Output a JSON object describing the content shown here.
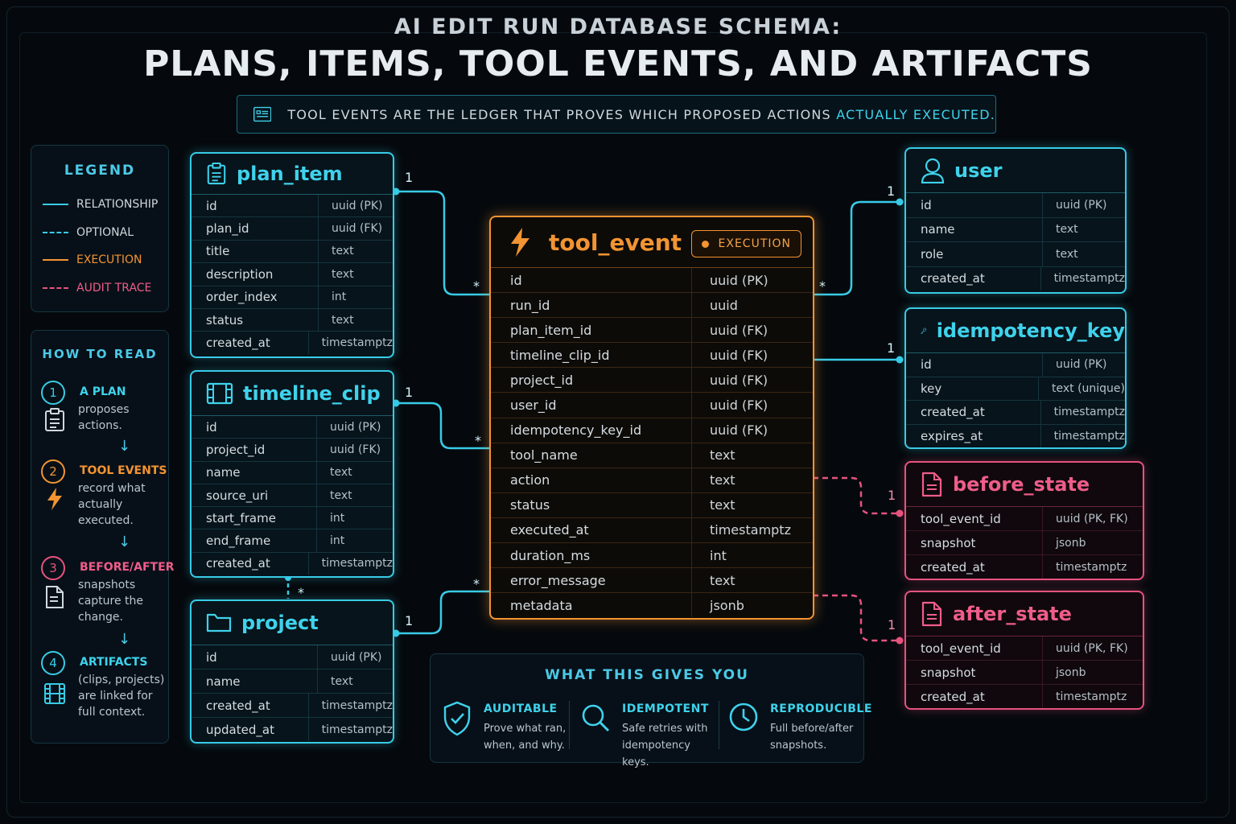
{
  "header": {
    "title_small": "AI EDIT RUN DATABASE SCHEMA:",
    "title_large": "PLANS, ITEMS, TOOL EVENTS, AND ARTIFACTS",
    "banner_text": "TOOL EVENTS ARE THE LEDGER THAT PROVES WHICH PROPOSED ACTIONS ",
    "banner_highlight": "ACTUALLY EXECUTED."
  },
  "legend": {
    "title": "LEGEND",
    "items": [
      {
        "label": "RELATIONSHIP",
        "color": "#38cbe6",
        "style": "solid"
      },
      {
        "label": "OPTIONAL",
        "color": "#38cbe6",
        "style": "dashed"
      },
      {
        "label": "EXECUTION",
        "color": "#f39432",
        "style": "solid"
      },
      {
        "label": "AUDIT TRACE",
        "color": "#e6537f",
        "style": "dashed"
      }
    ]
  },
  "how_to_read": {
    "title": "HOW TO READ",
    "steps": [
      {
        "num": "1",
        "head": "A PLAN",
        "body": "proposes actions.",
        "color": "#38cbe6"
      },
      {
        "num": "2",
        "head": "TOOL EVENTS",
        "body": "record what actually executed.",
        "color": "#f39432"
      },
      {
        "num": "3",
        "head": "BEFORE/AFTER",
        "body": "snapshots capture the change.",
        "color": "#e6537f"
      },
      {
        "num": "4",
        "head": "ARTIFACTS",
        "body": "(clips, projects) are linked for full context.",
        "color": "#38cbe6"
      }
    ],
    "arrow": "↓"
  },
  "tables": {
    "plan_item": {
      "name": "plan_item",
      "icon": "clipboard-icon",
      "columns": [
        [
          "id",
          "uuid (PK)"
        ],
        [
          "plan_id",
          "uuid (FK)"
        ],
        [
          "title",
          "text"
        ],
        [
          "description",
          "text"
        ],
        [
          "order_index",
          "int"
        ],
        [
          "status",
          "text"
        ],
        [
          "created_at",
          "timestamptz"
        ]
      ]
    },
    "timeline_clip": {
      "name": "timeline_clip",
      "icon": "film-icon",
      "columns": [
        [
          "id",
          "uuid (PK)"
        ],
        [
          "project_id",
          "uuid (FK)"
        ],
        [
          "name",
          "text"
        ],
        [
          "source_uri",
          "text"
        ],
        [
          "start_frame",
          "int"
        ],
        [
          "end_frame",
          "int"
        ],
        [
          "created_at",
          "timestamptz"
        ]
      ]
    },
    "project": {
      "name": "project",
      "icon": "folder-icon",
      "columns": [
        [
          "id",
          "uuid (PK)"
        ],
        [
          "name",
          "text"
        ],
        [
          "created_at",
          "timestamptz"
        ],
        [
          "updated_at",
          "timestamptz"
        ]
      ]
    },
    "tool_event": {
      "name": "tool_event",
      "icon": "lightning-icon",
      "badge": "EXECUTION",
      "columns": [
        [
          "id",
          "uuid (PK)"
        ],
        [
          "run_id",
          "uuid"
        ],
        [
          "plan_item_id",
          "uuid (FK)"
        ],
        [
          "timeline_clip_id",
          "uuid (FK)"
        ],
        [
          "project_id",
          "uuid (FK)"
        ],
        [
          "user_id",
          "uuid (FK)"
        ],
        [
          "idempotency_key_id",
          "uuid (FK)"
        ],
        [
          "tool_name",
          "text"
        ],
        [
          "action",
          "text"
        ],
        [
          "status",
          "text"
        ],
        [
          "executed_at",
          "timestamptz"
        ],
        [
          "duration_ms",
          "int"
        ],
        [
          "error_message",
          "text"
        ],
        [
          "metadata",
          "jsonb"
        ]
      ]
    },
    "user": {
      "name": "user",
      "icon": "user-icon",
      "columns": [
        [
          "id",
          "uuid (PK)"
        ],
        [
          "name",
          "text"
        ],
        [
          "role",
          "text"
        ],
        [
          "created_at",
          "timestamptz"
        ]
      ]
    },
    "idempotency_key": {
      "name": "idempotency_key",
      "icon": "key-icon",
      "columns": [
        [
          "id",
          "uuid (PK)"
        ],
        [
          "key",
          "text (unique)"
        ],
        [
          "created_at",
          "timestamptz"
        ],
        [
          "expires_at",
          "timestamptz"
        ]
      ]
    },
    "before_state": {
      "name": "before_state",
      "icon": "document-icon",
      "columns": [
        [
          "tool_event_id",
          "uuid (PK, FK)"
        ],
        [
          "snapshot",
          "jsonb"
        ],
        [
          "created_at",
          "timestamptz"
        ]
      ]
    },
    "after_state": {
      "name": "after_state",
      "icon": "document-icon",
      "columns": [
        [
          "tool_event_id",
          "uuid (PK, FK)"
        ],
        [
          "snapshot",
          "jsonb"
        ],
        [
          "created_at",
          "timestamptz"
        ]
      ]
    }
  },
  "cardinality": {
    "plan_item_one": "1",
    "plan_item_many": "*",
    "timeline_clip_one": "1",
    "timeline_clip_many": "*",
    "project_one": "1",
    "project_many": "*",
    "clip_project_many": "*",
    "user_one": "1",
    "user_many": "*",
    "idem_one": "1",
    "before_one": "1",
    "after_one": "1"
  },
  "benefits": {
    "title": "WHAT THIS GIVES YOU",
    "items": [
      {
        "head": "AUDITABLE",
        "body": "Prove what ran, when, and why.",
        "icon": "shield-check-icon"
      },
      {
        "head": "IDEMPOTENT",
        "body": "Safe retries with idempotency keys.",
        "icon": "magnifier-icon"
      },
      {
        "head": "REPRODUCIBLE",
        "body": "Full before/after snapshots.",
        "icon": "clock-icon"
      }
    ]
  },
  "colors": {
    "cyan": "#38cbe6",
    "orange": "#f39432",
    "pink": "#e6537f",
    "background": "#05090d"
  }
}
